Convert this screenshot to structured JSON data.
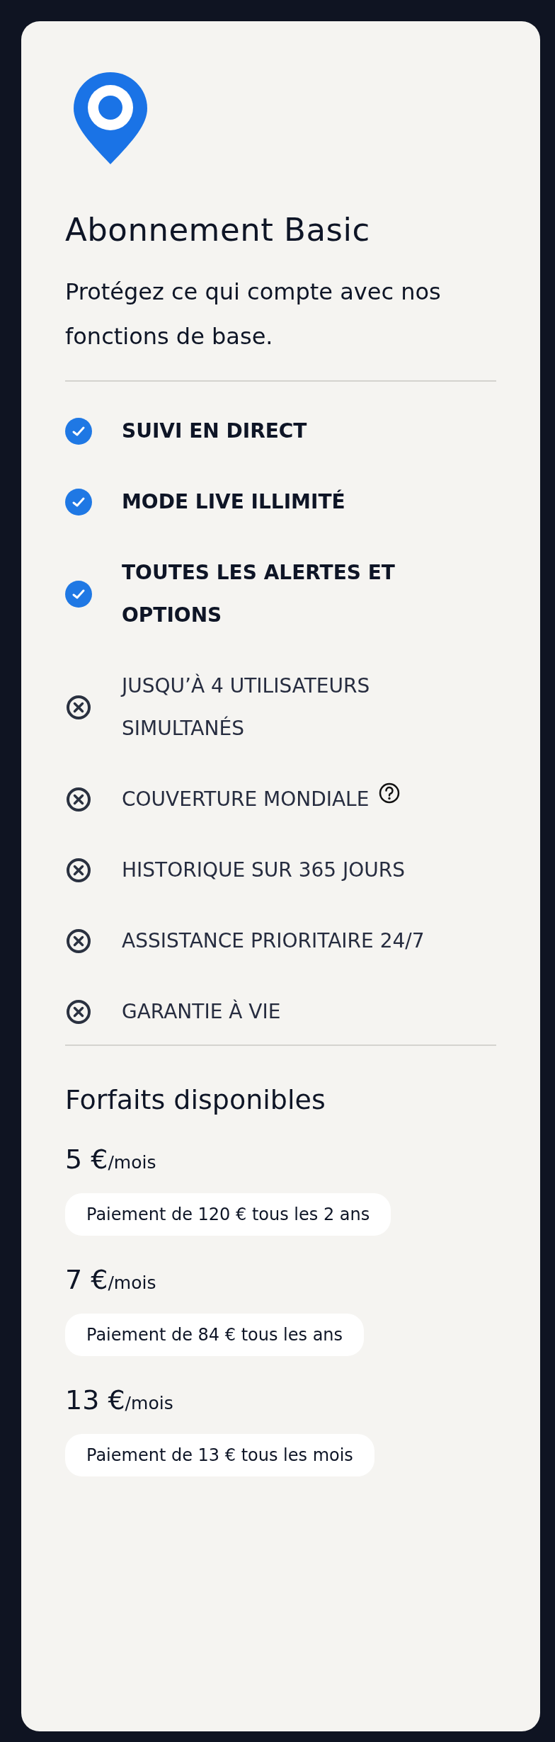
{
  "card": {
    "title": "Abonnement Basic",
    "subtitle": "Protégez ce qui compte avec nos fonctions de base.",
    "features": [
      {
        "label": "SUIVI EN DIRECT",
        "included": true,
        "help": false
      },
      {
        "label": "MODE LIVE ILLIMITÉ",
        "included": true,
        "help": false
      },
      {
        "label": "TOUTES LES ALERTES ET OPTIONS",
        "included": true,
        "help": false
      },
      {
        "label": "JUSQU’À 4 UTILISATEURS SIMULTANÉS",
        "included": false,
        "help": false
      },
      {
        "label": "COUVERTURE MONDIALE",
        "included": false,
        "help": true
      },
      {
        "label": "HISTORIQUE SUR 365 JOURS",
        "included": false,
        "help": false
      },
      {
        "label": "ASSISTANCE PRIORITAIRE 24/7",
        "included": false,
        "help": false
      },
      {
        "label": "GARANTIE À VIE",
        "included": false,
        "help": false
      }
    ],
    "plans_heading": "Forfaits disponibles",
    "plans": [
      {
        "amount": "5 €",
        "unit": "/mois",
        "billing": "Paiement de 120 € tous les 2 ans"
      },
      {
        "amount": "7 €",
        "unit": "/mois",
        "billing": "Paiement de 84 € tous les ans"
      },
      {
        "amount": "13 €",
        "unit": "/mois",
        "billing": "Paiement de 13 € tous les mois"
      }
    ]
  }
}
